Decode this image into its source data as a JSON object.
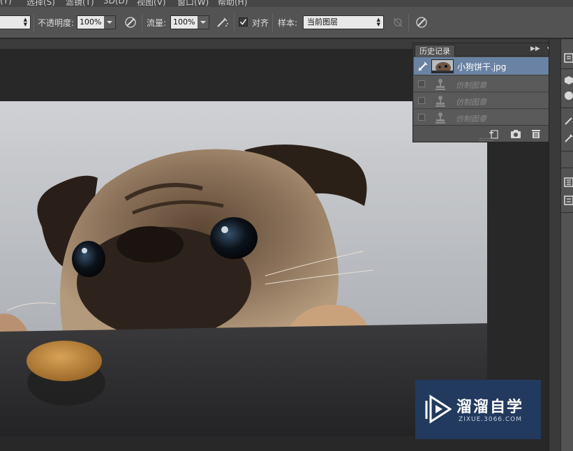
{
  "menubar": {
    "items": [
      "(Y)",
      "选择(S)",
      "滤镜(T)",
      "3D(D)",
      "视图(V)",
      "窗口(W)",
      "帮助(H)"
    ]
  },
  "options": {
    "opacity_label": "不透明度:",
    "opacity_value": "100%",
    "flow_label": "流量:",
    "flow_value": "100%",
    "align_label": "对齐",
    "align_checked": true,
    "sample_label": "样本:",
    "sample_value": "当前图层"
  },
  "history": {
    "tab_label": "历史记录",
    "snapshot_label": "小狗饼干.jpg",
    "steps": [
      {
        "label": "仿制图章"
      },
      {
        "label": "仿制图章"
      },
      {
        "label": "仿制图章"
      }
    ]
  },
  "watermark": {
    "title": "溜溜自学",
    "url": "ZIXUE.3066.COM"
  },
  "colors": {
    "panel_bg": "#535353",
    "selected_row": "#6a82a3",
    "workspace": "#282828",
    "watermark_bg": "#223a5e"
  },
  "icons": {
    "options": [
      "brush-pressure-icon",
      "airbrush-icon",
      "sample-ignore-adjust-icon",
      "brush-pressure-size-icon"
    ],
    "history_footer": [
      "new-document-icon",
      "camera-icon",
      "trash-icon"
    ],
    "dock": [
      "history-dock-icon",
      "3d-dock-icon",
      "color-dock-icon",
      "brush-dock-icon",
      "clone-source-dock-icon",
      "info-dock-icon",
      "layers-dock-icon"
    ]
  }
}
